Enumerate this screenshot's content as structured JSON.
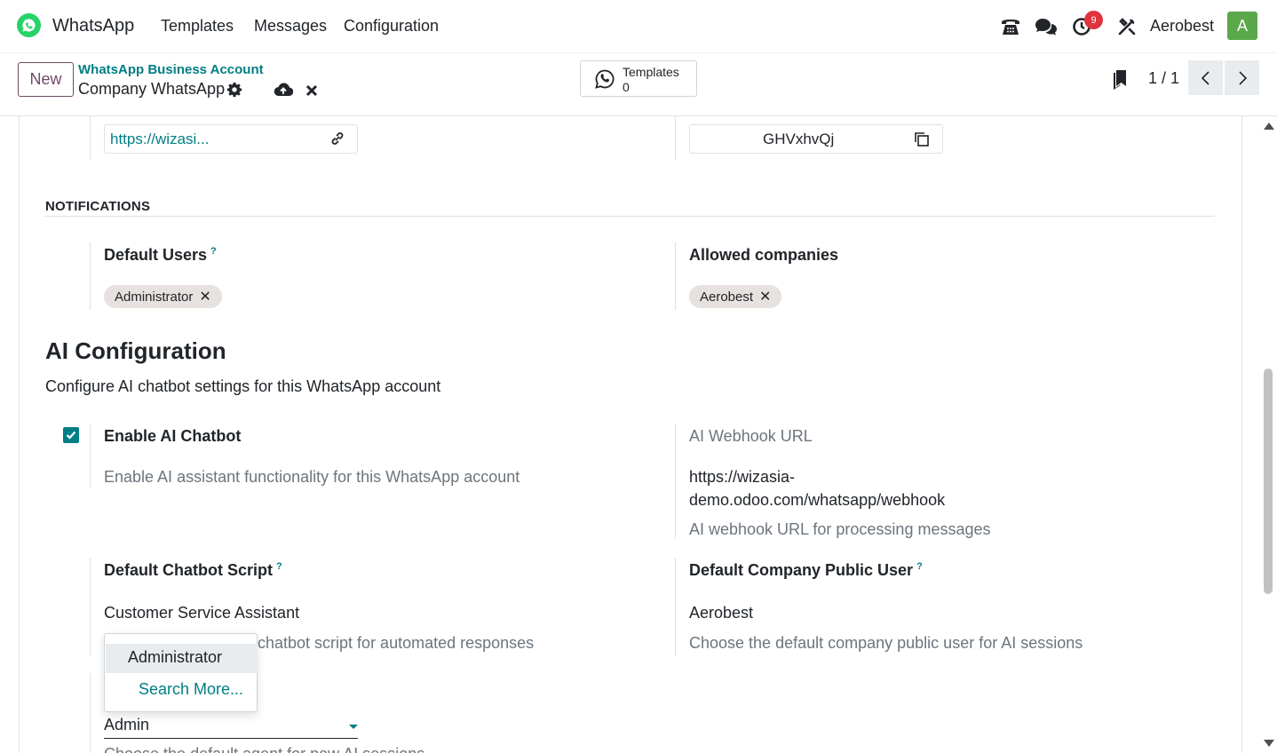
{
  "navbar": {
    "app_name": "WhatsApp",
    "menus": [
      "Templates",
      "Messages",
      "Configuration"
    ],
    "activity_badge": "9",
    "company": "Aerobest",
    "avatar_letter": "A",
    "icons": [
      "phone-icon",
      "chat-icon",
      "activity-clock-icon",
      "debug-tools-icon"
    ]
  },
  "control_panel": {
    "new_label": "New",
    "breadcrumb_parent": "WhatsApp Business Account",
    "breadcrumb_current": "Company WhatsApp",
    "smart_button": {
      "label": "Templates",
      "count": "0"
    },
    "pager": "1 / 1"
  },
  "top_fields": {
    "callback_url_value": "https://wizasi...",
    "verify_token_value": "GHVxhvQj"
  },
  "notifications": {
    "title": "NOTIFICATIONS",
    "default_users_label": "Default Users",
    "default_users_tags": [
      "Administrator"
    ],
    "allowed_companies_label": "Allowed companies",
    "allowed_companies_tags": [
      "Aerobest"
    ],
    "help_mark": "?"
  },
  "ai_config": {
    "title": "AI Configuration",
    "subtitle": "Configure AI chatbot settings for this WhatsApp account",
    "enable_label": "Enable AI Chatbot",
    "enable_help": "Enable AI assistant functionality for this WhatsApp account",
    "enable_checked": true,
    "webhook_label": "AI Webhook URL",
    "webhook_url_line1": "https://wizasia-",
    "webhook_url_line2": "demo.odoo.com/whatsapp/webhook",
    "webhook_help": "AI webhook URL for processing messages",
    "script_label": "Default Chatbot Script",
    "script_value": "Customer Service Assistant",
    "script_help_visible": "chatbot script for automated responses",
    "public_user_label": "Default Company Public User",
    "public_user_value": "Aerobest",
    "public_user_help": "Choose the default company public user for AI sessions",
    "agent_input_value": "Admin",
    "agent_help_cut": "Choose the default agent for new AI sessions"
  },
  "dropdown": {
    "options": [
      "Administrator"
    ],
    "search_more": "Search More..."
  },
  "colors": {
    "primary": "#714b67",
    "link": "#017e84",
    "badge": "#e0333f",
    "whatsapp": "#25d366"
  }
}
